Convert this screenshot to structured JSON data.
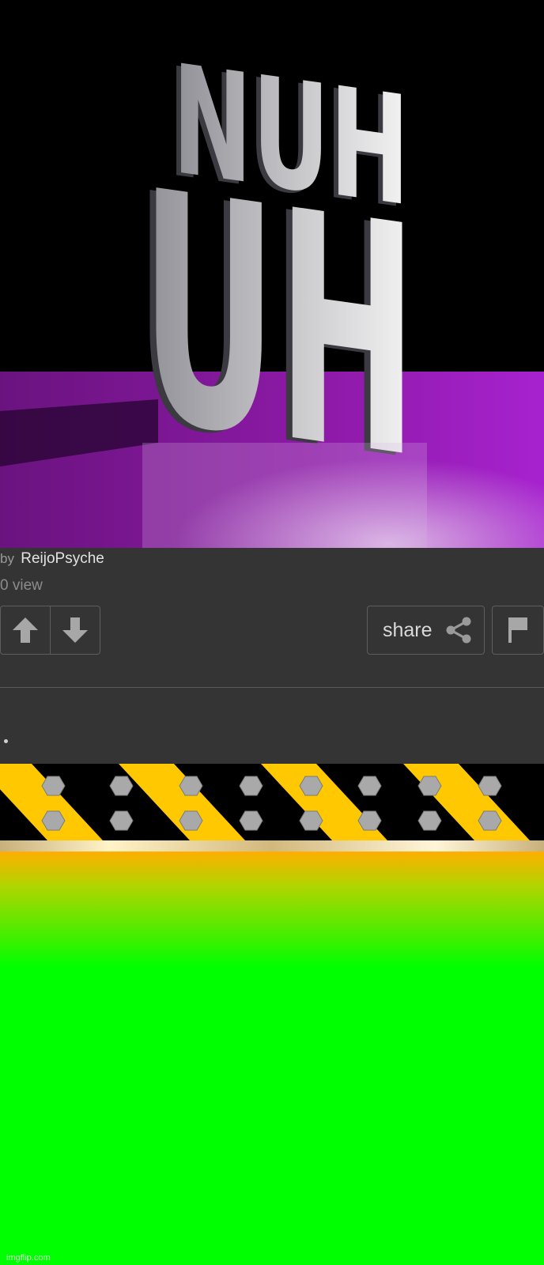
{
  "meme": {
    "line1": "NUH",
    "line2": "UH"
  },
  "post": {
    "by_label": "by",
    "author": "ReijoPsyche",
    "views": "0 view"
  },
  "actions": {
    "upvote_icon": "arrow-up-icon",
    "downvote_icon": "arrow-down-icon",
    "share_label": "share",
    "share_icon": "share-icon",
    "flag_icon": "flag-icon"
  },
  "caption": {
    "text": "."
  },
  "watermark": "imgflip.com",
  "colors": {
    "panel_bg": "#343434",
    "border": "#5e5e5e",
    "purple_floor": "#9b1fc4",
    "hazard_yellow": "#ffc800",
    "green": "#00ff00"
  }
}
